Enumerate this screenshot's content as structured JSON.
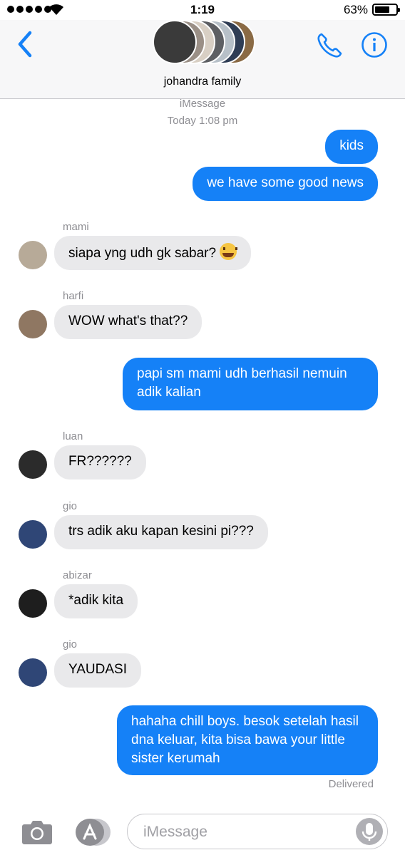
{
  "status_bar": {
    "time": "1:19",
    "battery": "63%"
  },
  "header": {
    "group_name": "johandra family"
  },
  "thread": {
    "service": "iMessage",
    "timestamp": "Today 1:08 pm"
  },
  "messages": [
    {
      "from": "me",
      "text": "kids"
    },
    {
      "from": "me",
      "text": "we have some good news"
    },
    {
      "from": "mami",
      "sender": "mami",
      "text": "siapa yng udh gk sabar?"
    },
    {
      "from": "harfi",
      "sender": "harfi",
      "text": "WOW what's that??"
    },
    {
      "from": "me",
      "text": "papi sm mami udh berhasil nemuin adik kalian"
    },
    {
      "from": "luan",
      "sender": "luan",
      "text": "FR??????"
    },
    {
      "from": "gio",
      "sender": "gio",
      "text": "trs adik aku kapan kesini pi???"
    },
    {
      "from": "abizar",
      "sender": "abizar",
      "text": "*adik kita"
    },
    {
      "from": "gio",
      "sender": "gio",
      "text": "YAUDASI"
    },
    {
      "from": "me",
      "text": "hahaha chill boys. besok setelah hasil dna keluar, kita bisa bawa your little sister kerumah"
    }
  ],
  "delivered": "Delivered",
  "composer": {
    "placeholder": "iMessage"
  },
  "colors": {
    "accent": "#1581f7",
    "incoming": "#e9e9eb",
    "meta": "#8e8e93"
  }
}
